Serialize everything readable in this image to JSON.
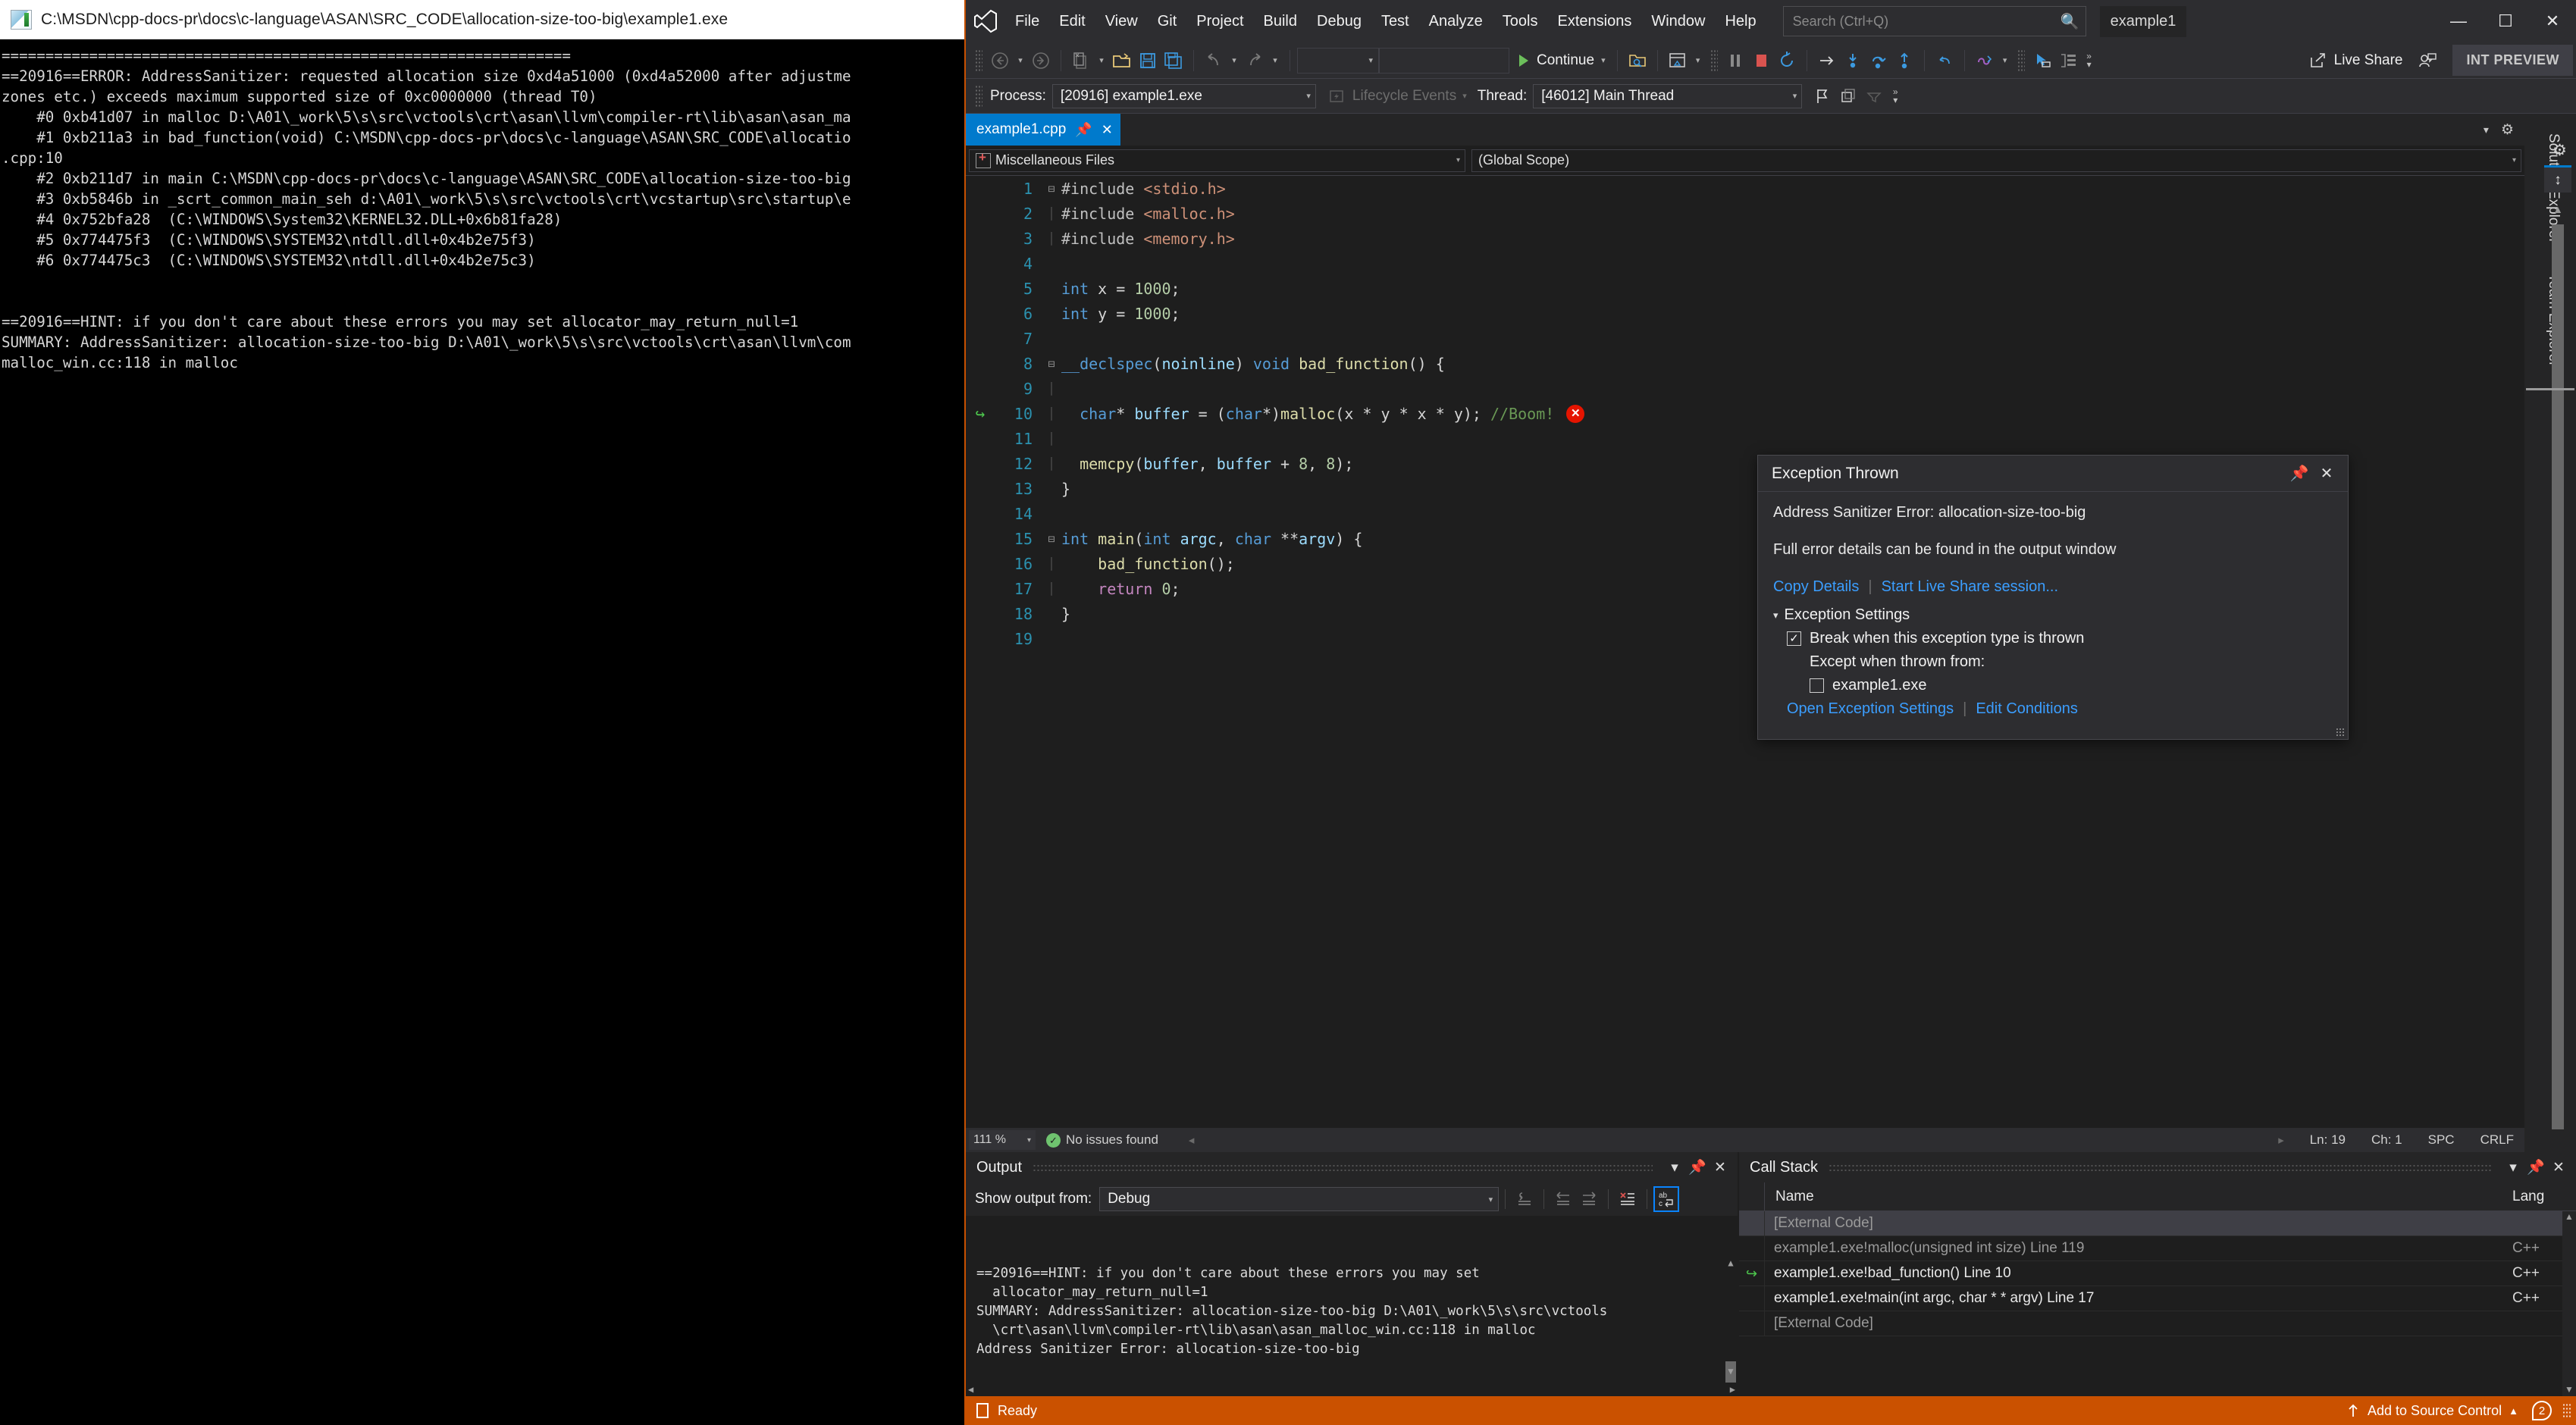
{
  "console": {
    "title": "C:\\MSDN\\cpp-docs-pr\\docs\\c-language\\ASAN\\SRC_CODE\\allocation-size-too-big\\example1.exe",
    "icon": "console-window-icon",
    "lines": [
      "=================================================================",
      "==20916==ERROR: AddressSanitizer: requested allocation size 0xd4a51000 (0xd4a52000 after adjustme",
      "zones etc.) exceeds maximum supported size of 0xc0000000 (thread T0)",
      "    #0 0xb41d07 in malloc D:\\A01\\_work\\5\\s\\src\\vctools\\crt\\asan\\llvm\\compiler-rt\\lib\\asan\\asan_ma",
      "    #1 0xb211a3 in bad_function(void) C:\\MSDN\\cpp-docs-pr\\docs\\c-language\\ASAN\\SRC_CODE\\allocatio",
      ".cpp:10",
      "    #2 0xb211d7 in main C:\\MSDN\\cpp-docs-pr\\docs\\c-language\\ASAN\\SRC_CODE\\allocation-size-too-big",
      "    #3 0xb5846b in _scrt_common_main_seh d:\\A01\\_work\\5\\s\\src\\vctools\\crt\\vcstartup\\src\\startup\\e",
      "    #4 0x752bfa28  (C:\\WINDOWS\\System32\\KERNEL32.DLL+0x6b81fa28)",
      "    #5 0x774475f3  (C:\\WINDOWS\\SYSTEM32\\ntdll.dll+0x4b2e75f3)",
      "    #6 0x774475c3  (C:\\WINDOWS\\SYSTEM32\\ntdll.dll+0x4b2e75c3)",
      "",
      "",
      "==20916==HINT: if you don't care about these errors you may set allocator_may_return_null=1",
      "SUMMARY: AddressSanitizer: allocation-size-too-big D:\\A01\\_work\\5\\s\\src\\vctools\\crt\\asan\\llvm\\com",
      "malloc_win.cc:118 in malloc"
    ]
  },
  "titlebar": {
    "logo": "visual-studio-logo",
    "menus": [
      "File",
      "Edit",
      "View",
      "Git",
      "Project",
      "Build",
      "Debug",
      "Test",
      "Analyze",
      "Tools",
      "Extensions",
      "Window",
      "Help"
    ],
    "search_placeholder": "Search (Ctrl+Q)",
    "solution_name": "example1",
    "minimize": "—",
    "maximize": "☐",
    "close": "✕"
  },
  "toolbar": {
    "continue_label": "Continue",
    "live_share_label": "Live Share",
    "preview_badge": "INT PREVIEW",
    "icons": [
      "navigate-back-icon",
      "navigate-forward-icon",
      "new-item-icon",
      "open-file-icon",
      "save-icon",
      "save-all-icon",
      "undo-icon",
      "redo-icon",
      "start-debug-icon",
      "attach-icon",
      "window-layout-icon",
      "pause-icon",
      "stop-icon",
      "restart-icon",
      "show-next-statement-icon",
      "step-into-icon",
      "step-over-icon",
      "step-out-icon",
      "step-back-icon",
      "hot-reload-icon",
      "select-element-icon",
      "layout-panel-icon",
      "live-share-icon",
      "invite-icon"
    ]
  },
  "debug_bar": {
    "process_label": "Process:",
    "process_value": "[20916] example1.exe",
    "lifecycle_label": "Lifecycle Events",
    "thread_label": "Thread:",
    "thread_value": "[46012] Main Thread",
    "icons": [
      "flag-icon",
      "stack-frame-icon",
      "breakpoint-filter-icon"
    ]
  },
  "editor": {
    "tab_label": "example1.cpp",
    "tab_pin_icon": "pin-icon",
    "tab_close_icon": "close-icon",
    "nav_left_value": "Miscellaneous Files",
    "nav_left_icon": "miscellaneous-files-icon",
    "nav_right_value": "(Global Scope)",
    "current_line_marker": "execution-point-arrow-icon",
    "error_marker": "error-marker-icon",
    "error_marker_glyph": "✕",
    "lines": [
      {
        "n": "1",
        "fold": "⊟",
        "guide": false,
        "tokens": [
          [
            "pp",
            "#include "
          ],
          [
            "str",
            "<stdio.h>"
          ]
        ]
      },
      {
        "n": "2",
        "fold": "",
        "guide": true,
        "tokens": [
          [
            "pp",
            "#include "
          ],
          [
            "str",
            "<malloc.h>"
          ]
        ]
      },
      {
        "n": "3",
        "fold": "",
        "guide": true,
        "tokens": [
          [
            "pp",
            "#include "
          ],
          [
            "str",
            "<memory.h>"
          ]
        ]
      },
      {
        "n": "4",
        "fold": "",
        "guide": false,
        "tokens": []
      },
      {
        "n": "5",
        "fold": "",
        "guide": false,
        "tokens": [
          [
            "kw",
            "int"
          ],
          [
            "plain",
            " x = "
          ],
          [
            "num",
            "1000"
          ],
          [
            "plain",
            ";"
          ]
        ]
      },
      {
        "n": "6",
        "fold": "",
        "guide": false,
        "tokens": [
          [
            "kw",
            "int"
          ],
          [
            "plain",
            " y = "
          ],
          [
            "num",
            "1000"
          ],
          [
            "plain",
            ";"
          ]
        ]
      },
      {
        "n": "7",
        "fold": "",
        "guide": false,
        "tokens": []
      },
      {
        "n": "8",
        "fold": "⊟",
        "guide": false,
        "tokens": [
          [
            "kw",
            "__declspec"
          ],
          [
            "plain",
            "("
          ],
          [
            "var",
            "noinline"
          ],
          [
            "plain",
            ") "
          ],
          [
            "kw",
            "void"
          ],
          [
            "plain",
            " "
          ],
          [
            "fn",
            "bad_function"
          ],
          [
            "plain",
            "() {"
          ]
        ]
      },
      {
        "n": "9",
        "fold": "",
        "guide": true,
        "tokens": []
      },
      {
        "n": "10",
        "fold": "",
        "guide": true,
        "mark": true,
        "error": true,
        "tokens": [
          [
            "plain",
            "  "
          ],
          [
            "kw",
            "char"
          ],
          [
            "plain",
            "* "
          ],
          [
            "var",
            "buffer"
          ],
          [
            "plain",
            " = ("
          ],
          [
            "kw",
            "char"
          ],
          [
            "plain",
            "*)"
          ],
          [
            "fn",
            "malloc"
          ],
          [
            "plain",
            "(x * y * x * y); "
          ],
          [
            "cmt",
            "//Boom!"
          ]
        ]
      },
      {
        "n": "11",
        "fold": "",
        "guide": true,
        "tokens": []
      },
      {
        "n": "12",
        "fold": "",
        "guide": true,
        "tokens": [
          [
            "plain",
            "  "
          ],
          [
            "fn",
            "memcpy"
          ],
          [
            "plain",
            "("
          ],
          [
            "var",
            "buffer"
          ],
          [
            "plain",
            ", "
          ],
          [
            "var",
            "buffer"
          ],
          [
            "plain",
            " + "
          ],
          [
            "num",
            "8"
          ],
          [
            "plain",
            ", "
          ],
          [
            "num",
            "8"
          ],
          [
            "plain",
            ");"
          ]
        ]
      },
      {
        "n": "13",
        "fold": "",
        "guide": false,
        "tokens": [
          [
            "plain",
            "}"
          ]
        ]
      },
      {
        "n": "14",
        "fold": "",
        "guide": false,
        "tokens": []
      },
      {
        "n": "15",
        "fold": "⊟",
        "guide": false,
        "tokens": [
          [
            "kw",
            "int"
          ],
          [
            "plain",
            " "
          ],
          [
            "fn",
            "main"
          ],
          [
            "plain",
            "("
          ],
          [
            "kw",
            "int"
          ],
          [
            "plain",
            " "
          ],
          [
            "var",
            "argc"
          ],
          [
            "plain",
            ", "
          ],
          [
            "kw",
            "char"
          ],
          [
            "plain",
            " **"
          ],
          [
            "var",
            "argv"
          ],
          [
            "plain",
            ") {"
          ]
        ]
      },
      {
        "n": "16",
        "fold": "",
        "guide": true,
        "tokens": [
          [
            "plain",
            "    "
          ],
          [
            "fn",
            "bad_function"
          ],
          [
            "plain",
            "();"
          ]
        ]
      },
      {
        "n": "17",
        "fold": "",
        "guide": true,
        "tokens": [
          [
            "plain",
            "    "
          ],
          [
            "ctl",
            "return"
          ],
          [
            "plain",
            " "
          ],
          [
            "num",
            "0"
          ],
          [
            "plain",
            ";"
          ]
        ]
      },
      {
        "n": "18",
        "fold": "",
        "guide": false,
        "tokens": [
          [
            "plain",
            "}"
          ]
        ]
      },
      {
        "n": "19",
        "fold": "",
        "guide": false,
        "tokens": []
      }
    ],
    "statusbar": {
      "zoom": "111 %",
      "issues": "No issues found",
      "line": "Ln: 19",
      "col": "Ch: 1",
      "spaces": "SPC",
      "eol": "CRLF"
    }
  },
  "exception_popup": {
    "title": "Exception Thrown",
    "pin_icon": "pin-icon",
    "close_icon": "close-icon",
    "message": "Address Sanitizer Error: allocation-size-too-big",
    "detail": "Full error details can be found in the output window",
    "copy_details": "Copy Details",
    "live_share": "Start Live Share session...",
    "settings_header": "Exception Settings",
    "break_label": "Break when this exception type is thrown",
    "break_checked": true,
    "except_label": "Except when thrown from:",
    "module_label": "example1.exe",
    "module_checked": false,
    "open_settings": "Open Exception Settings",
    "edit_conditions": "Edit Conditions",
    "check_glyph": "✓"
  },
  "right_rail": {
    "tabs": [
      "Solution Explorer",
      "Team Explorer"
    ],
    "gear_icon": "gear-icon",
    "splitter_icon": "split-window-icon"
  },
  "output_panel": {
    "title": "Output",
    "dropdown_icon": "chevron-down-icon",
    "pin_icon": "pin-icon",
    "close_icon": "close-icon",
    "show_output_label": "Show output from:",
    "show_output_value": "Debug",
    "toolbar_icons": [
      "go-to-source-icon",
      "navigate-back-icon",
      "navigate-forward-icon",
      "clear-all-icon",
      "word-wrap-icon"
    ],
    "lines": [
      "==20916==HINT: if you don't care about these errors you may set",
      "  allocator_may_return_null=1",
      "SUMMARY: AddressSanitizer: allocation-size-too-big D:\\A01\\_work\\5\\s\\src\\vctools",
      "  \\crt\\asan\\llvm\\compiler-rt\\lib\\asan\\asan_malloc_win.cc:118 in malloc",
      "Address Sanitizer Error: allocation-size-too-big"
    ]
  },
  "callstack_panel": {
    "title": "Call Stack",
    "dropdown_icon": "chevron-down-icon",
    "pin_icon": "pin-icon",
    "close_icon": "close-icon",
    "columns": [
      "Name",
      "Lang"
    ],
    "rows": [
      {
        "marker": "",
        "name": "[External Code]",
        "lang": "",
        "external": true,
        "selected": true
      },
      {
        "marker": "",
        "name": "example1.exe!malloc(unsigned int size) Line 119",
        "lang": "C++",
        "external": true,
        "selected": false
      },
      {
        "marker": "↪",
        "name": "example1.exe!bad_function() Line 10",
        "lang": "C++",
        "external": false,
        "selected": false
      },
      {
        "marker": "",
        "name": "example1.exe!main(int argc, char * * argv) Line 17",
        "lang": "C++",
        "external": false,
        "selected": false
      },
      {
        "marker": "",
        "name": "[External Code]",
        "lang": "",
        "external": true,
        "selected": false
      }
    ]
  },
  "statusbar": {
    "ready": "Ready",
    "source_control": "Add to Source Control",
    "source_control_caret": "▲",
    "notification_count": "2",
    "accent_color": "#ca5100"
  }
}
